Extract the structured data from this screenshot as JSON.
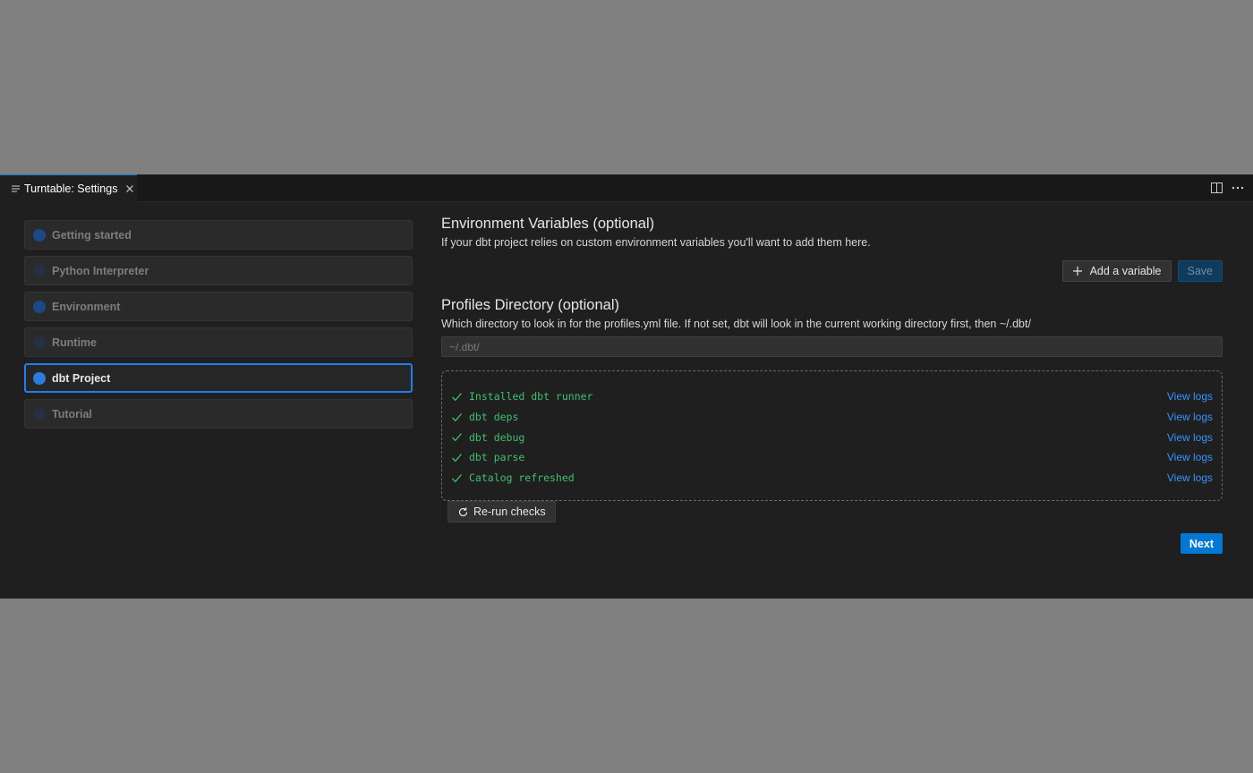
{
  "tab": {
    "title": "Turntable: Settings",
    "icon": "lines-icon"
  },
  "tabbar_actions": [
    "split-editor-icon",
    "more-actions-icon"
  ],
  "sidebar": {
    "steps": [
      {
        "label": "Getting started",
        "dot_color": "#1a4a86"
      },
      {
        "label": "Python Interpreter",
        "dot_color": "#263040"
      },
      {
        "label": "Environment",
        "dot_color": "#1a4a86"
      },
      {
        "label": "Runtime",
        "dot_color": "#263040"
      },
      {
        "label": "dbt Project",
        "dot_color": "#2a7de0",
        "active": true
      },
      {
        "label": "Tutorial",
        "dot_color": "#263040"
      }
    ]
  },
  "env": {
    "title": "Environment Variables (optional)",
    "description": "If your dbt project relies on custom environment variables you'll want to add them here.",
    "add_label": "Add a variable",
    "save_label": "Save"
  },
  "profiles": {
    "title": "Profiles Directory (optional)",
    "description": "Which directory to look in for the profiles.yml file. If not set, dbt will look in the current working directory first, then ~/.dbt/",
    "placeholder": "~/.dbt/",
    "value": ""
  },
  "checks": {
    "items": [
      {
        "label": "Installed dbt runner",
        "link": "View logs"
      },
      {
        "label": "dbt deps",
        "link": "View logs"
      },
      {
        "label": "dbt debug",
        "link": "View logs"
      },
      {
        "label": "dbt parse",
        "link": "View logs"
      },
      {
        "label": "Catalog refreshed",
        "link": "View logs"
      }
    ],
    "rerun_label": "Re-run checks"
  },
  "next_label": "Next",
  "colors": {
    "accent": "#0078d4",
    "success": "#3fc06a",
    "link": "#3794ff"
  }
}
